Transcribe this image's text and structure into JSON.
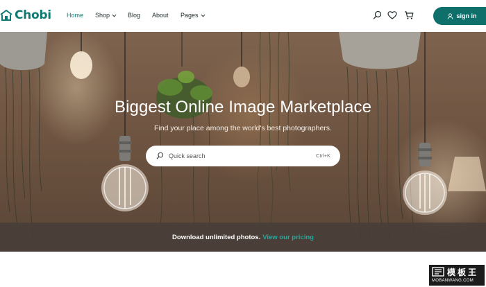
{
  "brand": {
    "name": "Chobi",
    "color": "#0f7a72"
  },
  "nav": {
    "items": [
      {
        "label": "Home",
        "active": true
      },
      {
        "label": "Shop",
        "dropdown": true
      },
      {
        "label": "Blog"
      },
      {
        "label": "About"
      },
      {
        "label": "Pages",
        "dropdown": true
      }
    ],
    "icons": [
      "search-icon",
      "heart-icon",
      "cart-icon"
    ],
    "signin_label": "sign in"
  },
  "hero": {
    "title": "Biggest Online Image Marketplace",
    "subtitle": "Find your place among the world's best photographers.",
    "search": {
      "placeholder": "Quick search",
      "shortcut": "Ctrl+K"
    },
    "banner_text": "Download unlimited photos.",
    "banner_link": "View our pricing",
    "link_color": "#24a89c"
  },
  "watermark": {
    "top": "模板王",
    "bottom": "MOBANWANG.COM"
  }
}
